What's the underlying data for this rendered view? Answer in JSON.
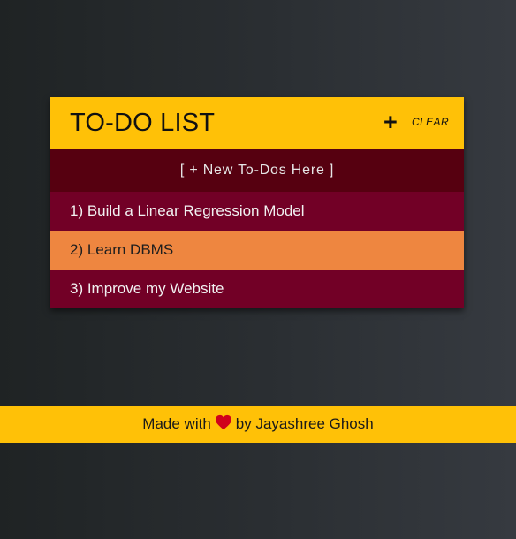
{
  "header": {
    "title": "TO-DO LIST",
    "add_icon": "+",
    "clear_label": "CLEAR"
  },
  "new_todo": {
    "placeholder": "[ + New To-Dos Here  ]"
  },
  "todos": [
    {
      "text": "1) Build a Linear Regression Model"
    },
    {
      "text": "2) Learn DBMS"
    },
    {
      "text": "3) Improve my Website"
    }
  ],
  "footer": {
    "prefix": "Made with",
    "heart_icon": "heart-icon",
    "suffix": "by Jayashree Ghosh"
  },
  "colors": {
    "header": "#ffc107",
    "new_row": "#560010",
    "item_dark": "#720026",
    "item_highlight": "#ee8640",
    "heart": "#d0021b"
  }
}
